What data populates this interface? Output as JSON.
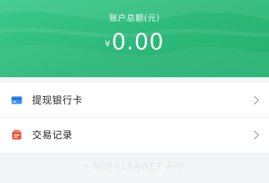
{
  "header": {
    "balance_label": "账户总额(元)",
    "currency_symbol": "¥",
    "balance_amount": "0.00",
    "background_color": "#2cb878"
  },
  "menu": {
    "items": [
      {
        "label": "提现银行卡",
        "icon": "bank-card-icon",
        "icon_color": "#3d8ff0"
      },
      {
        "label": "交易记录",
        "icon": "transaction-record-icon",
        "icon_color": "#e8553a"
      }
    ],
    "chevron_icon": "chevron-right-icon"
  },
  "watermark": {
    "text": "• NOFKLXAWET APP"
  }
}
